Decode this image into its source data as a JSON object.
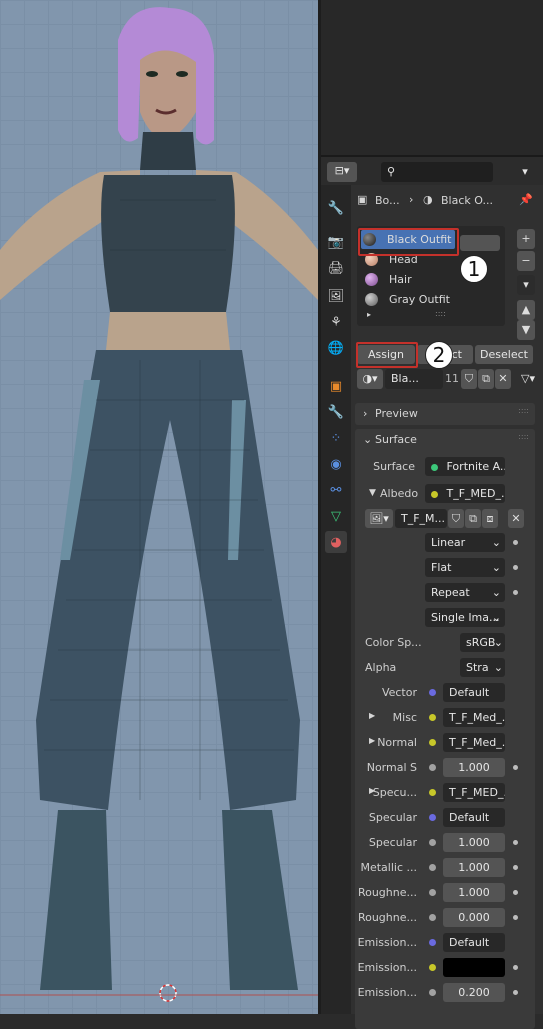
{
  "properties": {
    "breadcrumb": {
      "object": "Bo...",
      "material": "Black O..."
    },
    "material_slots": [
      "Black Outfit",
      "Head",
      "Hair",
      "Gray Outfit"
    ],
    "slot_colors": [
      "#3a3a3a",
      "#e0a98a",
      "#b27bc0",
      "#9a9a9a"
    ],
    "buttons": {
      "assign": "Assign",
      "select": "Select",
      "deselect": "Deselect"
    },
    "material_name": "Bla...",
    "user_count": "11",
    "panels": {
      "preview": "Preview",
      "surface": "Surface"
    },
    "surface": {
      "surface_label": "Surface",
      "surface_value": "Fortnite A...",
      "albedo_label": "Albedo",
      "albedo_value": "T_F_MED_...",
      "image_name": "T_F_M...",
      "interpolation": "Linear",
      "projection": "Flat",
      "extension": "Repeat",
      "source": "Single Ima...",
      "color_space_label": "Color Sp...",
      "color_space_value": "sRGB",
      "alpha_label": "Alpha",
      "alpha_value": "Stra",
      "inputs": [
        {
          "label": "Vector",
          "value": "Default",
          "expand": false,
          "kind": "link",
          "socket": "#6a6ae0"
        },
        {
          "label": "Misc",
          "value": "T_F_Med_...",
          "expand": true,
          "kind": "link",
          "socket": "#c7c729"
        },
        {
          "label": "Normal",
          "value": "T_F_Med_...",
          "expand": true,
          "kind": "link",
          "socket": "#c7c729"
        },
        {
          "label": "Normal S",
          "value": "1.000",
          "expand": false,
          "kind": "num",
          "socket": "#a1a1a1"
        },
        {
          "label": "Specu...",
          "value": "T_F_MED_...",
          "expand": true,
          "kind": "link",
          "socket": "#c7c729"
        },
        {
          "label": "Specular",
          "value": "Default",
          "expand": false,
          "kind": "link",
          "socket": "#6a6ae0"
        },
        {
          "label": "Specular",
          "value": "1.000",
          "expand": false,
          "kind": "num",
          "socket": "#a1a1a1"
        },
        {
          "label": "Metallic ...",
          "value": "1.000",
          "expand": false,
          "kind": "num",
          "socket": "#a1a1a1"
        },
        {
          "label": "Roughne...",
          "value": "1.000",
          "expand": false,
          "kind": "num",
          "socket": "#a1a1a1"
        },
        {
          "label": "Roughne...",
          "value": "0.000",
          "expand": false,
          "kind": "num",
          "socket": "#a1a1a1"
        },
        {
          "label": "Emission...",
          "value": "Default",
          "expand": false,
          "kind": "link",
          "socket": "#6a6ae0"
        },
        {
          "label": "Emission...",
          "value": "",
          "expand": false,
          "kind": "color",
          "socket": "#c7c729"
        },
        {
          "label": "Emission...",
          "value": "0.200",
          "expand": false,
          "kind": "num",
          "socket": "#a1a1a1"
        }
      ]
    }
  },
  "annotations": [
    "1",
    "2"
  ],
  "colors": {
    "highlight": "#c4312b",
    "viewport": "#8196ad"
  }
}
